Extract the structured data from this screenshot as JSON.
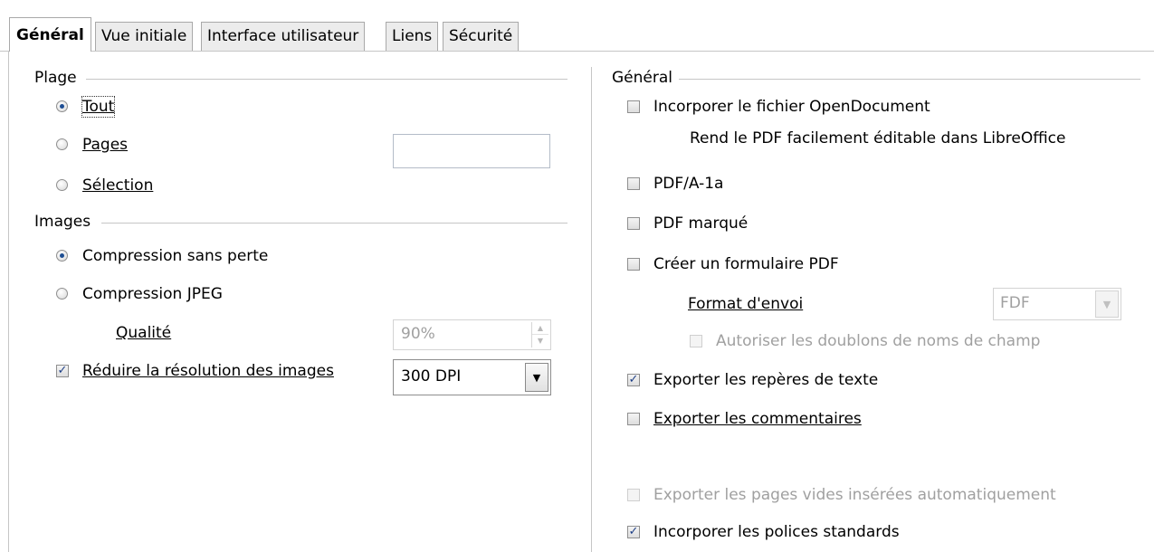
{
  "tabs": [
    {
      "label": "Général",
      "active": true
    },
    {
      "label": "Vue initiale",
      "active": false
    },
    {
      "label": "Interface utilisateur",
      "active": false
    },
    {
      "label": "Liens",
      "active": false
    },
    {
      "label": "Sécurité",
      "active": false
    }
  ],
  "left": {
    "range_section": "Plage",
    "range_options": [
      {
        "label": "Tout",
        "checked": true
      },
      {
        "label": "Pages",
        "checked": false
      },
      {
        "label": "Sélection",
        "checked": false
      }
    ],
    "pages_input_value": "",
    "images_section": "Images",
    "image_options": [
      {
        "label": "Compression sans perte",
        "checked": true
      },
      {
        "label": "Compression JPEG",
        "checked": false
      }
    ],
    "quality_label": "Qualité",
    "quality_value": "90%",
    "reduce_resolution_label": "Réduire la résolution des images",
    "reduce_resolution_checked": true,
    "resolution_value": "300 DPI"
  },
  "right": {
    "section": "Général",
    "embed_od_label": "Incorporer le fichier OpenDocument",
    "embed_od_note": "Rend le PDF facilement éditable dans LibreOffice",
    "pdfa_label": "PDF/A-1a",
    "tagged_pdf_label": "PDF marqué",
    "create_form_label": "Créer un formulaire PDF",
    "submit_format_label": "Format d'envoi",
    "submit_format_value": "FDF",
    "allow_duplicates_label": "Autoriser les doublons de noms de champ",
    "export_bookmarks_label": "Exporter les repères de texte",
    "export_bookmarks_checked": true,
    "export_comments_label": "Exporter les commentaires",
    "export_blank_pages_label": "Exporter les pages vides insérées automatiquement",
    "embed_fonts_label": "Incorporer les polices standards",
    "embed_fonts_checked": true
  },
  "icons": {
    "check_glyph": "✓",
    "dropdown_glyph": "▼",
    "spin_up_glyph": "▲",
    "spin_down_glyph": "▼"
  },
  "colors": {
    "accent": "#1e4e93",
    "disabled_text": "#a0a0a0",
    "border": "#c6c6c6"
  }
}
